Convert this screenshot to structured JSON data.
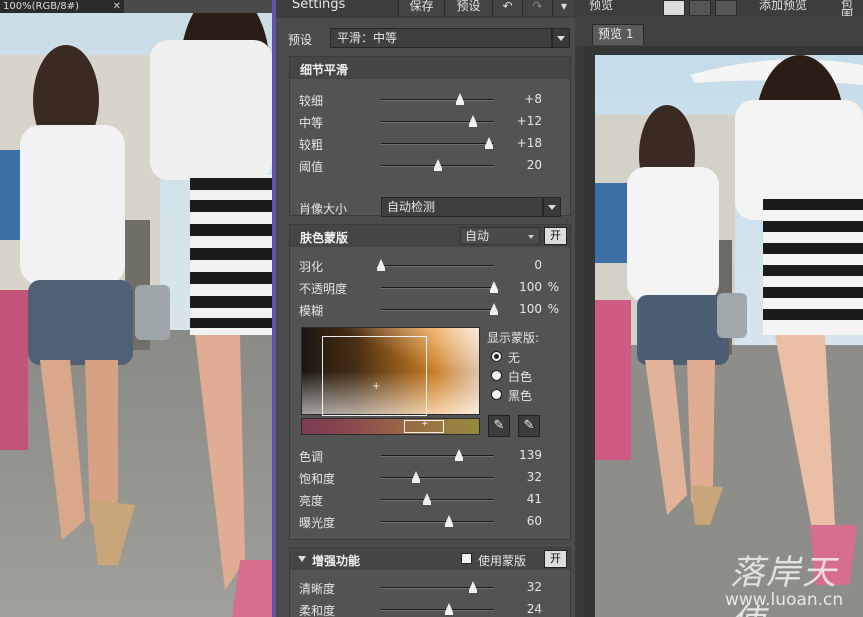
{
  "left_doc": {
    "tab_title": "100%(RGB/8#)"
  },
  "panel": {
    "title": "Settings",
    "save": "保存",
    "preset_btn": "预设",
    "preset_label": "预设",
    "preset_value": "平滑：中等",
    "detail": {
      "title": "细节平滑",
      "rows": [
        {
          "label": "较细",
          "value": "+8",
          "pos": 0.7
        },
        {
          "label": "中等",
          "value": "+12",
          "pos": 0.81
        },
        {
          "label": "较粗",
          "value": "+18",
          "pos": 0.96
        },
        {
          "label": "阈值",
          "value": "20",
          "pos": 0.5
        }
      ],
      "face_label": "肖像大小",
      "face_value": "自动检测"
    },
    "skin": {
      "title": "肤色蒙版",
      "mode": "自动",
      "on": "开",
      "rows": [
        {
          "label": "羽化",
          "value": "0",
          "pos": 0.0,
          "unit": ""
        },
        {
          "label": "不透明度",
          "value": "100",
          "pos": 1.0,
          "unit": "%"
        },
        {
          "label": "模糊",
          "value": "100",
          "pos": 1.0,
          "unit": "%"
        }
      ],
      "show_mask": "显示蒙版:",
      "radios": [
        "无",
        "白色",
        "黑色"
      ],
      "adjust": [
        {
          "label": "色调",
          "value": "139",
          "pos": 0.69
        },
        {
          "label": "饱和度",
          "value": "32",
          "pos": 0.31
        },
        {
          "label": "亮度",
          "value": "41",
          "pos": 0.41
        },
        {
          "label": "曝光度",
          "value": "60",
          "pos": 0.6
        }
      ]
    },
    "enhance": {
      "title": "增强功能",
      "use_mask": "使用蒙版",
      "on": "开",
      "rows": [
        {
          "label": "清晰度",
          "value": "32",
          "pos": 0.81
        },
        {
          "label": "柔和度",
          "value": "24",
          "pos": 0.6
        }
      ]
    }
  },
  "preview": {
    "label": "预览",
    "add_preview": "添加预览",
    "pack": "包围",
    "tab": "预览 1",
    "watermark_cn": "落岸天使",
    "watermark_url": "www.luoan.cn"
  },
  "colors": {
    "divider": "#5c57a6",
    "panel_bg": "#4b4b4b"
  }
}
